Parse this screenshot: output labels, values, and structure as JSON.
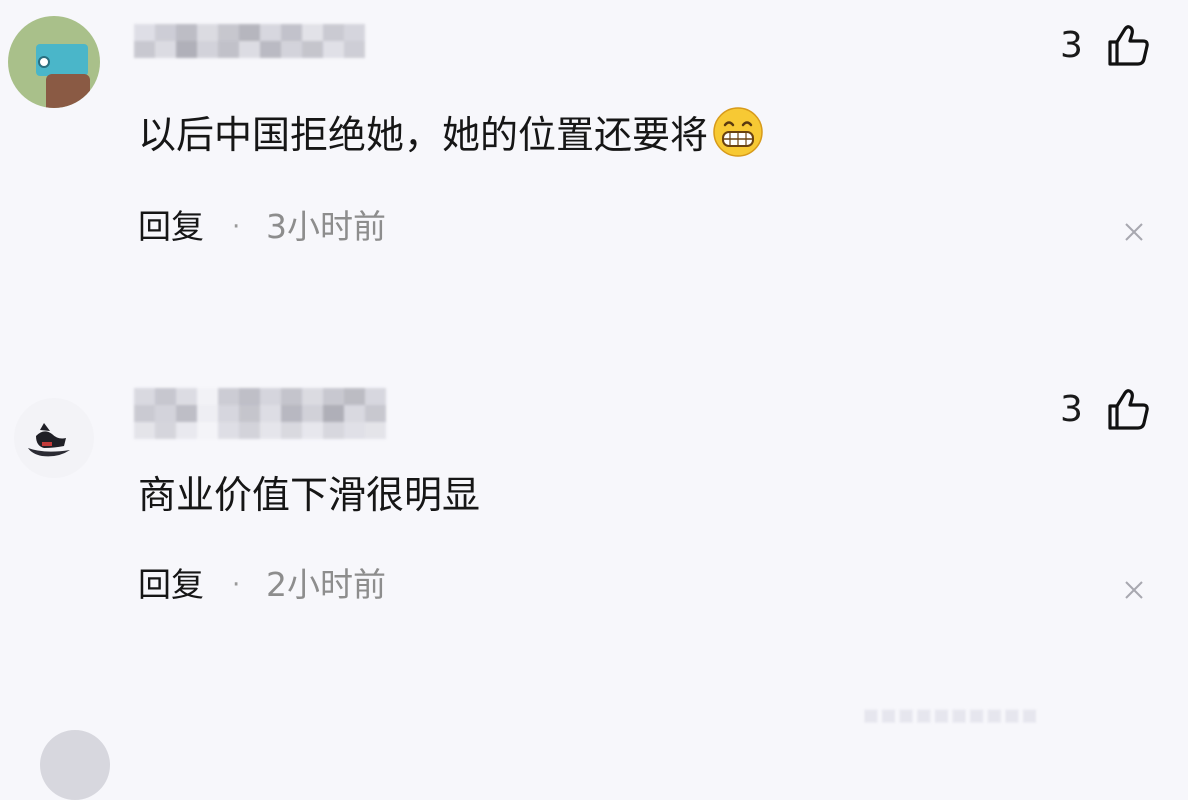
{
  "comments": [
    {
      "text": "以后中国拒绝她，她的位置还要将",
      "emoji": "grinning-face-emoji",
      "likes": "3",
      "reply_label": "回复",
      "separator": "·",
      "time": "3小时前"
    },
    {
      "text": "商业价值下滑很明显",
      "likes": "3",
      "reply_label": "回复",
      "separator": "·",
      "time": "2小时前"
    }
  ],
  "icons": {
    "like": "thumbs-up-icon",
    "close": "close-icon"
  },
  "colors": {
    "background": "#f7f7fb",
    "text": "#161616",
    "muted": "#8d8d8d"
  }
}
